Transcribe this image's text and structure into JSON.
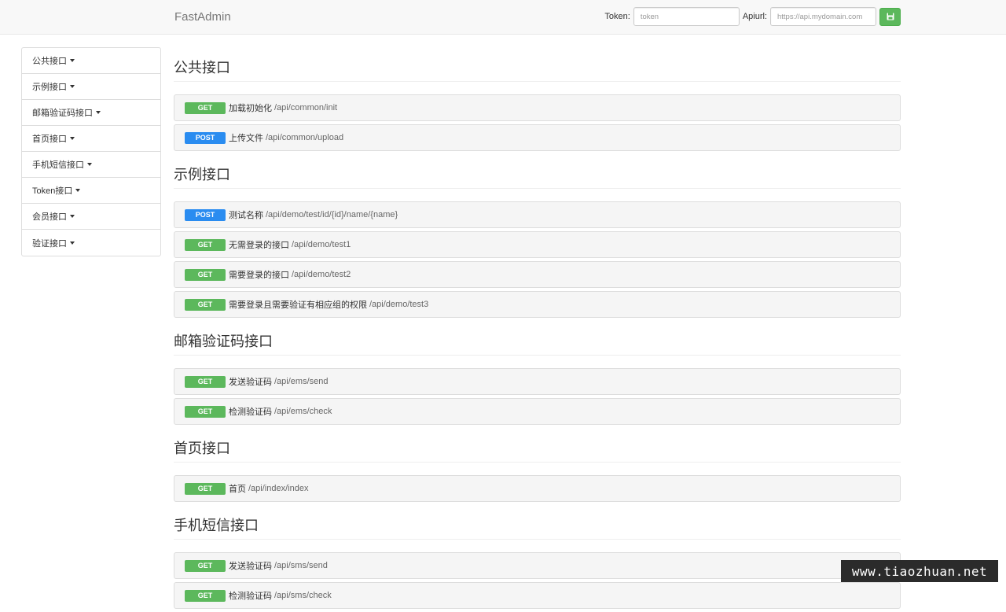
{
  "navbar": {
    "brand": "FastAdmin",
    "token_label": "Token:",
    "token_placeholder": "token",
    "apiurl_label": "Apiurl:",
    "apiurl_placeholder": "https://api.mydomain.com",
    "save_icon": "floppy-disk-icon"
  },
  "sidebar": {
    "items": [
      {
        "label": "公共接口"
      },
      {
        "label": "示例接口"
      },
      {
        "label": "邮箱验证码接口"
      },
      {
        "label": "首页接口"
      },
      {
        "label": "手机短信接口"
      },
      {
        "label": "Token接口"
      },
      {
        "label": "会员接口"
      },
      {
        "label": "验证接口"
      }
    ]
  },
  "sections": [
    {
      "title": "公共接口",
      "endpoints": [
        {
          "method": "GET",
          "title": "加载初始化",
          "path": "/api/common/init"
        },
        {
          "method": "POST",
          "title": "上传文件",
          "path": "/api/common/upload"
        }
      ]
    },
    {
      "title": "示例接口",
      "endpoints": [
        {
          "method": "POST",
          "title": "测试名称",
          "path": "/api/demo/test/id/{id}/name/{name}"
        },
        {
          "method": "GET",
          "title": "无需登录的接口",
          "path": "/api/demo/test1"
        },
        {
          "method": "GET",
          "title": "需要登录的接口",
          "path": "/api/demo/test2"
        },
        {
          "method": "GET",
          "title": "需要登录且需要验证有相应组的权限",
          "path": "/api/demo/test3"
        }
      ]
    },
    {
      "title": "邮箱验证码接口",
      "endpoints": [
        {
          "method": "GET",
          "title": "发送验证码",
          "path": "/api/ems/send"
        },
        {
          "method": "GET",
          "title": "检测验证码",
          "path": "/api/ems/check"
        }
      ]
    },
    {
      "title": "首页接口",
      "endpoints": [
        {
          "method": "GET",
          "title": "首页",
          "path": "/api/index/index"
        }
      ]
    },
    {
      "title": "手机短信接口",
      "endpoints": [
        {
          "method": "GET",
          "title": "发送验证码",
          "path": "/api/sms/send"
        },
        {
          "method": "GET",
          "title": "检测验证码",
          "path": "/api/sms/check"
        }
      ]
    }
  ],
  "watermark": "www.tiaozhuan.net",
  "colors": {
    "get": "#5cb85c",
    "post": "#2a8cf0",
    "save_button": "#5cb85c"
  }
}
